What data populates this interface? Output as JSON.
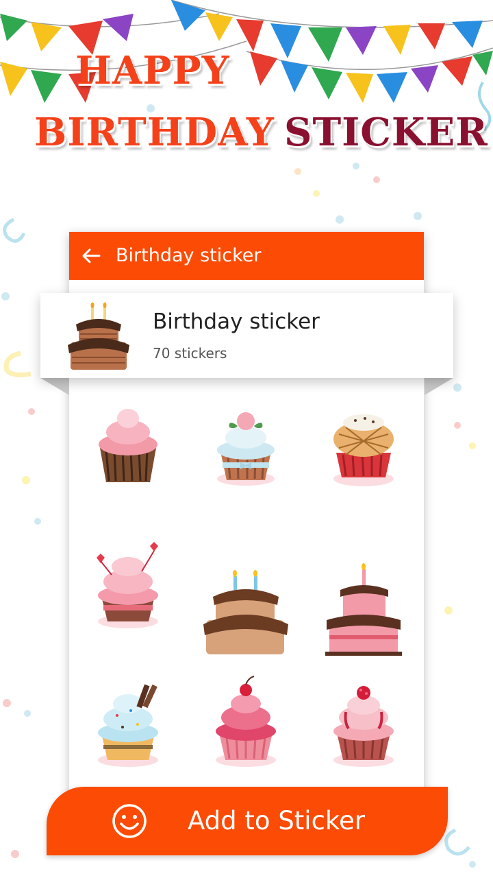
{
  "promo": {
    "line1": "HAPPY",
    "line2a": "BIRTHDAY",
    "line2b": "STICKER"
  },
  "appbar": {
    "title": "Birthday sticker",
    "back_icon": "arrow-left-icon"
  },
  "pack": {
    "name": "Birthday sticker",
    "count": "70 stickers",
    "icon": "cake-icon"
  },
  "stickers": [
    {
      "name": "pink-frosting-cupcake"
    },
    {
      "name": "rose-cupcake"
    },
    {
      "name": "waffle-cupcake"
    },
    {
      "name": "hearts-cupcake"
    },
    {
      "name": "chocolate-cake-candles"
    },
    {
      "name": "pink-layer-cake"
    },
    {
      "name": "blue-sprinkle-cupcake"
    },
    {
      "name": "cherry-cupcake"
    },
    {
      "name": "raspberry-cupcake"
    }
  ],
  "button": {
    "label": "Add to Sticker",
    "icon": "smiley-icon"
  },
  "colors": {
    "accent": "#fc4b05",
    "title_red": "#f4411a",
    "title_maroon": "#8a1030"
  }
}
